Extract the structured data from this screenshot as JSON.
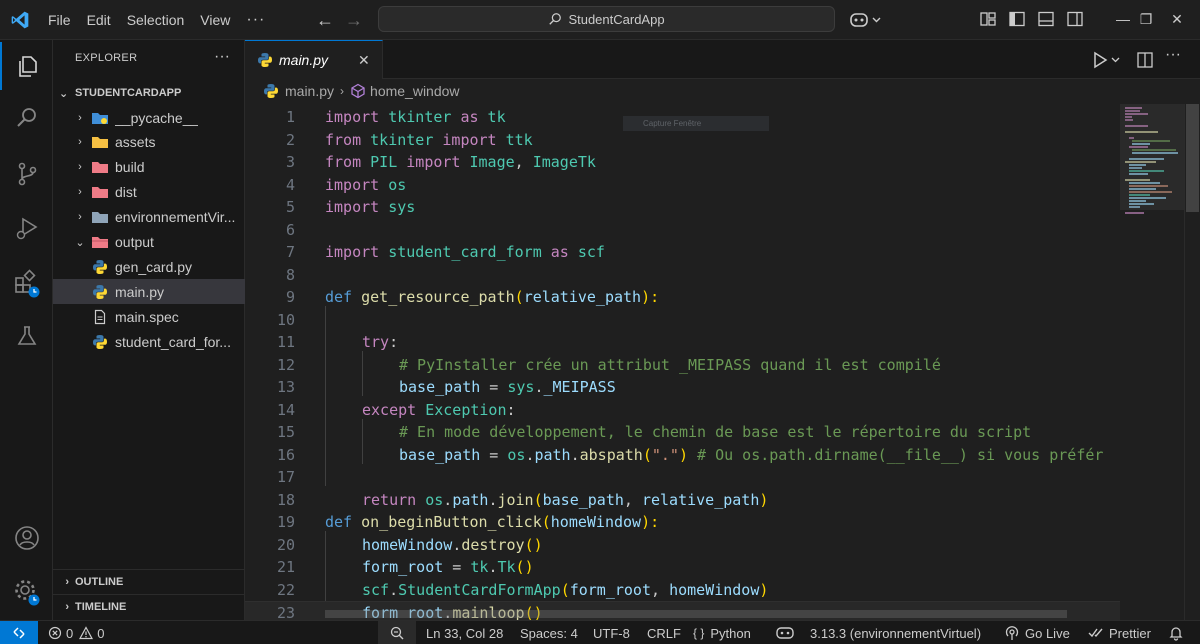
{
  "titlebar": {
    "menus": [
      "File",
      "Edit",
      "Selection",
      "View"
    ],
    "more": "···",
    "search_text": "StudentCardApp"
  },
  "activity_bar": {
    "items": [
      "explorer-icon",
      "search-icon",
      "source-control-icon",
      "run-debug-icon",
      "extensions-icon",
      "testing-icon"
    ],
    "bottom": [
      "account-icon",
      "settings-icon"
    ]
  },
  "sidebar": {
    "title": "EXPLORER",
    "more": "···",
    "root": "STUDENTCARDAPP",
    "items": [
      {
        "label": "__pycache__",
        "chev": "›",
        "icon": "folder-pycache-icon"
      },
      {
        "label": "assets",
        "chev": "›",
        "icon": "folder-assets-icon"
      },
      {
        "label": "build",
        "chev": "›",
        "icon": "folder-build-icon"
      },
      {
        "label": "dist",
        "chev": "›",
        "icon": "folder-dist-icon"
      },
      {
        "label": "environnementVir...",
        "chev": "›",
        "icon": "folder-icon"
      },
      {
        "label": "output",
        "chev": "⌄",
        "icon": "folder-output-icon"
      },
      {
        "label": "gen_card.py",
        "chev": "",
        "icon": "python-file-icon"
      },
      {
        "label": "main.py",
        "chev": "",
        "icon": "python-file-icon",
        "selected": true
      },
      {
        "label": "main.spec",
        "chev": "",
        "icon": "file-icon"
      },
      {
        "label": "student_card_for...",
        "chev": "",
        "icon": "python-file-icon"
      }
    ],
    "outline": "OUTLINE",
    "timeline": "TIMELINE"
  },
  "editor": {
    "tab_label": "main.py",
    "close": "✕",
    "breadcrumb_file": "main.py",
    "breadcrumb_symbol": "home_window",
    "overlay_hint": "Capture Fenêtre",
    "current_line": 23,
    "lines": [
      {
        "n": "1"
      },
      {
        "n": "2"
      },
      {
        "n": "3"
      },
      {
        "n": "4"
      },
      {
        "n": "5"
      },
      {
        "n": "6"
      },
      {
        "n": "7"
      },
      {
        "n": "8"
      },
      {
        "n": "9"
      },
      {
        "n": "10"
      },
      {
        "n": "11"
      },
      {
        "n": "12"
      },
      {
        "n": "13"
      },
      {
        "n": "14"
      },
      {
        "n": "15"
      },
      {
        "n": "16"
      },
      {
        "n": "17"
      },
      {
        "n": "18"
      },
      {
        "n": "19"
      },
      {
        "n": "20"
      },
      {
        "n": "21"
      },
      {
        "n": "22"
      },
      {
        "n": "23"
      }
    ],
    "code": {
      "l1": [
        "import",
        " tkinter ",
        "as",
        " tk"
      ],
      "l2": [
        "from",
        " tkinter ",
        "import",
        " ttk"
      ],
      "l3": [
        "from",
        " PIL ",
        "import",
        " Image",
        ",",
        " ImageTk"
      ],
      "l4": [
        "import",
        " os"
      ],
      "l5": [
        "import",
        " sys"
      ],
      "l7": [
        "import",
        " student_card_form ",
        "as",
        " scf"
      ],
      "l9": [
        "def",
        " ",
        "get_resource_path",
        "(",
        "relative_path",
        "):"
      ],
      "l11": [
        "try",
        ":"
      ],
      "l12": "# PyInstaller crée un attribut _MEIPASS quand il est compilé",
      "l13": [
        "base_path",
        " = ",
        "sys",
        ".",
        "_MEIPASS"
      ],
      "l14": [
        "except",
        " ",
        "Exception",
        ":"
      ],
      "l15": "# En mode développement, le chemin de base est le répertoire du script",
      "l16": [
        "base_path",
        " = ",
        "os",
        ".",
        "path",
        ".",
        "abspath",
        "(",
        "\".\"",
        ")",
        " ",
        "# Ou os.path.dirname(__file__) si vous préfér"
      ],
      "l18": [
        "return",
        " ",
        "os",
        ".",
        "path",
        ".",
        "join",
        "(",
        "base_path",
        ", ",
        "relative_path",
        ")"
      ],
      "l19": [
        "def",
        " ",
        "on_beginButton_click",
        "(",
        "homeWindow",
        "):"
      ],
      "l20": [
        "homeWindow",
        ".",
        "destroy",
        "(",
        ")"
      ],
      "l21": [
        "form_root",
        " = ",
        "tk",
        ".",
        "Tk",
        "(",
        ")"
      ],
      "l22": [
        "scf",
        ".",
        "StudentCardFormApp",
        "(",
        "form_root",
        ", ",
        "homeWindow",
        ")"
      ],
      "l23": [
        "form_root",
        ".",
        "mainloop",
        "(",
        ")"
      ]
    }
  },
  "statusbar": {
    "problems_errors": "0",
    "problems_warnings": "0",
    "position": "Ln 33, Col 28",
    "spaces": "Spaces: 4",
    "encoding": "UTF-8",
    "eol": "CRLF",
    "language": "Python",
    "interpreter": "3.13.3 (environnementVirtuel)",
    "golive": "Go Live",
    "prettier": "Prettier"
  },
  "colors": {
    "accent": "#0078d4",
    "keyword": "#c586c0",
    "string": "#ce9178",
    "comment": "#6a9955",
    "function": "#dcdcaa"
  }
}
